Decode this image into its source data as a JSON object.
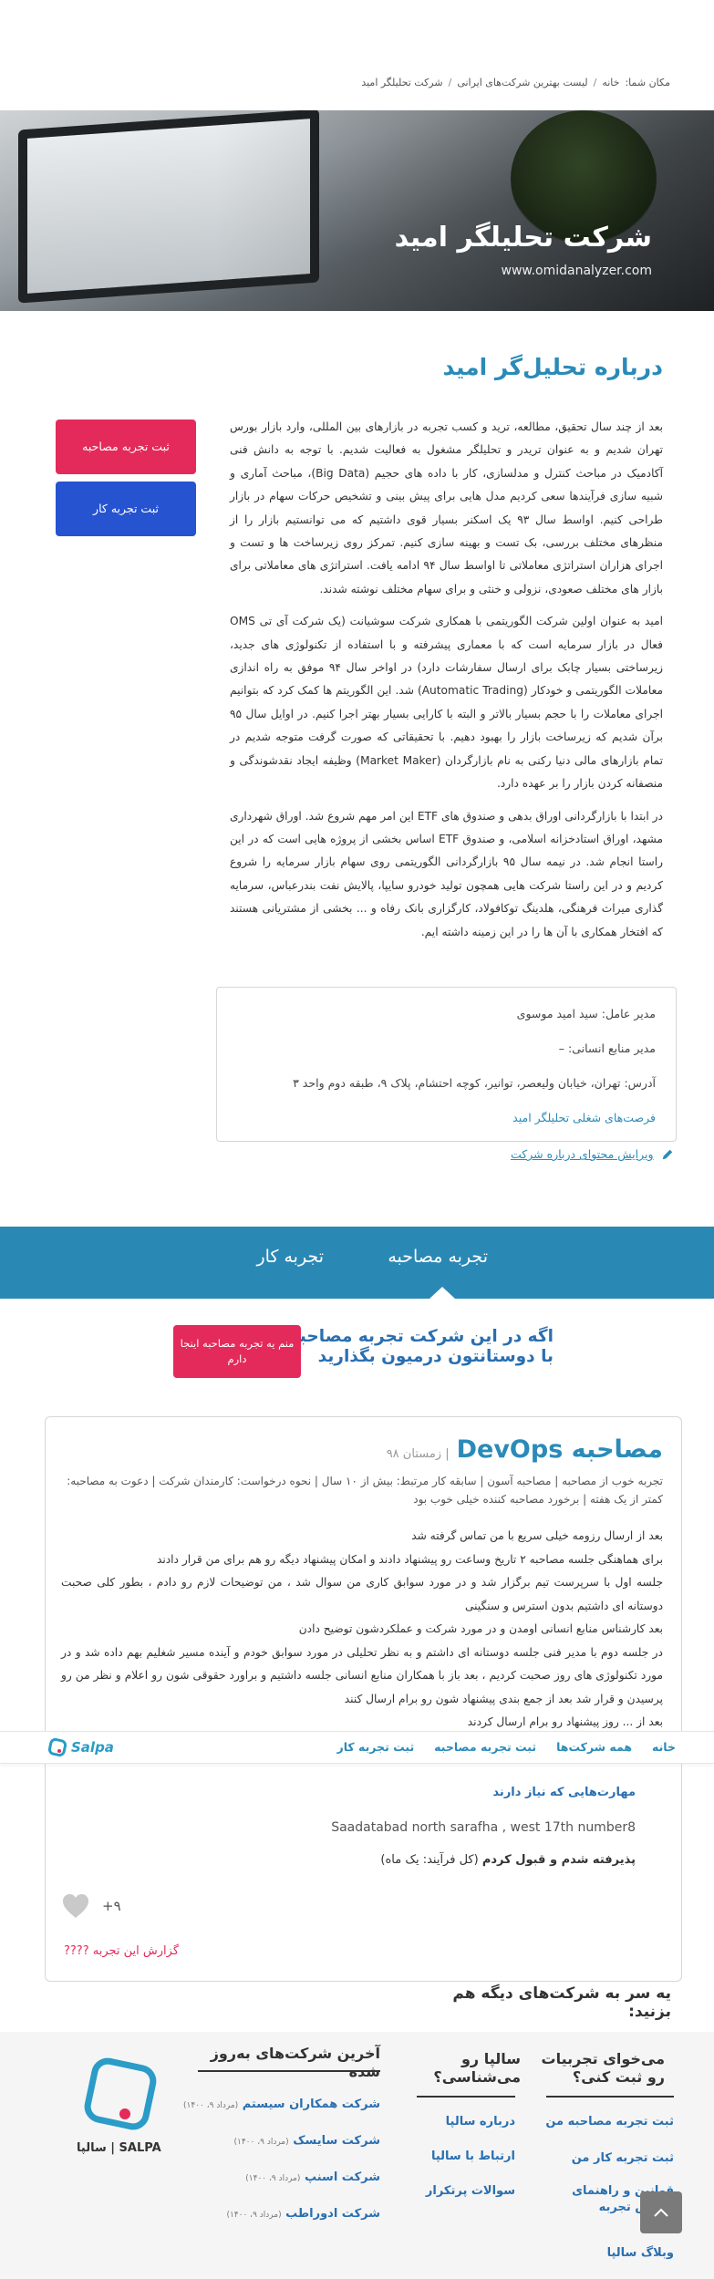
{
  "breadcrumb": {
    "label": "مکان شما:",
    "items": [
      "خانه",
      "لیست بهترین شرکت‌های ایرانی",
      "شرکت تحلیلگر امید"
    ],
    "sep": "/"
  },
  "hero": {
    "title": "شرکت تحلیلگر امید",
    "site": "www.omidanalyzer.com"
  },
  "about": {
    "title": "درباره تحلیل‌گر امید",
    "paragraphs": [
      "بعد از چند سال تحقیق، مطالعه، ترید و کسب تجربه در بازارهای بین المللی، وارد بازار بورس تهران شدیم و به عنوان تریدر و تحلیلگر مشغول به فعالیت شدیم. با توجه به دانش فنی آکادمیک در مباحث کنترل و مدلسازی، کار با داده های حجیم (Big Data)، مباحث آماری و شبیه سازی فرآیندها سعی کردیم مدل هایی برای پیش بینی و تشخیص حرکات سهام در بازار طراحی کنیم. اواسط سال ۹۳ یک اسکنر بسیار قوی داشتیم که می توانستیم بازار را از منظرهای مختلف بررسی، بک تست و بهینه سازی کنیم. تمرکز روی زیرساخت ها و تست و اجرای هزاران استراتژی معاملاتی تا اواسط سال ۹۴ ادامه یافت. استراتژی های معاملاتی برای بازار های مختلف صعودی، نزولی و خنثی و برای سهام مختلف نوشته شدند.",
      "امید به عنوان اولین شرکت الگوریتمی با همکاری شرکت سوشیانت (یک شرکت آی تی OMS فعال در بازار سرمایه است که با معماری پیشرفته و با استفاده از تکنولوژی های جدید، زیرساختی بسیار چابک برای ارسال سفارشات دارد) در اواخر سال ۹۴ موفق به راه اندازی معاملات الگوریتمی و خودکار (Automatic Trading) شد. این الگوریتم ها کمک کرد که بتوانیم اجرای معاملات را با حجم بسیار بالاتر و البته با کارایی بسیار بهتر اجرا کنیم. در اوایل سال ۹۵ برآن شدیم که زیرساخت بازار را بهبود دهیم. با تحقیقاتی که صورت گرفت متوجه شدیم در تمام بازارهای مالی دنیا رکنی به نام بازارگردان (Market Maker) وظیفه ایجاد نقدشوندگی و منصفانه کردن بازار را بر عهده دارد.",
      "در ابتدا با بازارگردانی اوراق بدهی و صندوق های ETF این امر مهم شروع شد. اوراق شهرداری مشهد، اوراق استادخزانه اسلامی، و صندوق ETF اساس بخشی از پروژه هایی است که در این راستا انجام شد. در نیمه سال ۹۵ بازارگردانی الگوریتمی روی سهام بازار سرمایه را شروع کردیم و در این راستا شرکت هایی همچون تولید خودرو سایپا، پالایش نفت بندرعباس، سرمایه گذاری میراث فرهنگی، هلدینگ توکافولاد، کارگزاری بانک رفاه و ... بخشی از مشتریانی هستند که افتخار همکاری با آن ها را در این زمینه داشته ایم."
    ]
  },
  "side_buttons": {
    "interview": "ثبت تجربه مصاحبه",
    "work": "ثبت تجربه کار"
  },
  "info": {
    "ceo": "مدیر عامل: سید امید موسوی",
    "hr": "مدیر منابع انسانی: –",
    "address": "آدرس: تهران، خیابان ولیعصر، توانیر، کوچه احتشام، پلاک ۹، طبقه دوم واحد ۳",
    "jobs_link": "فرصت‌های شغلی تحلیلگر امید",
    "edit_link": "ویرایش محتوای درباره شرکت"
  },
  "tabs": [
    "تجربه مصاحبه",
    "تجربه کار"
  ],
  "cta": {
    "line1": "اگه در این شرکت تجربه مصاحبه دارید،",
    "line2": "با دوستانتون درمیون بگذارید",
    "button": "منم یه تجربه مصاحبه اینجا دارم"
  },
  "review": {
    "title": "مصاحبه DevOps",
    "date": "| زمستان ۹۸",
    "meta": "تجربه خوب از مصاحبه | مصاحبه آسون | سابقه کار مرتبط: بیش از ۱۰ سال | نحوه درخواست: کارمندان شرکت | دعوت به مصاحبه: کمتر از یک هفته | برخورد مصاحبه کننده خیلی خوب بود",
    "body": [
      "بعد از ارسال رزومه خیلی سریع با من تماس گرفته شد",
      "برای هماهنگی جلسه مصاحبه ۲ تاریخ وساعت رو پیشنهاد دادند و امکان پیشنهاد دیگه رو هم برای من قرار دادند",
      "جلسه اول با سرپرست تیم برگزار شد و در مورد سوابق کاری من سوال شد ، من توضیحات لازم رو دادم ، بطور کلی صحبت دوستانه ای داشتیم بدون استرس و سنگینی",
      "بعد کارشناس منابع انسانی اومدن و در مورد شرکت و عملکردشون توضیح دادن",
      "در جلسه دوم با مدیر فنی جلسه دوستانه ای داشتم و به نظر تحلیلی در مورد سوابق خودم و آینده مسیر شغلیم بهم داده شد و در مورد تکنولوژی های روز صحبت کردیم ، بعد باز با همکاران منابع انسانی جلسه داشتیم و براورد حقوقی شون رو اعلام و نظر من رو پرسیدن و قرار شد بعد از جمع بندی پیشنهاد شون رو برام ارسال کنند",
      "بعد از ... روز پیشنهاد رو برام ارسال کردند"
    ],
    "skills_title": "مهارت‌هایی که نیاز دارند",
    "address": "Saadatabad north sarafha , west 17th number8",
    "accepted_bold": "پذیرفته شدم و قبول کردم",
    "accepted_rest": "(کل فرآیند: یک ماه)",
    "likes": "+۹",
    "report": "گزارش این تجربه ????"
  },
  "sticky_nav": {
    "logo": "Salpa",
    "items": [
      "خانه",
      "همه شرکت‌ها",
      "ثبت تجربه مصاحبه",
      "ثبت تجربه کار"
    ]
  },
  "see_also": {
    "line1": "یه سر به شرکت‌های دیگه هم",
    "line2": "بزنید:"
  },
  "footer": {
    "col1_title_1": "می‌خوای تجربیات",
    "col1_title_2": "رو ثبت کنی؟",
    "col1_links": [
      "ثبت تجربه مصاحبه من",
      "ثبت تجربه کار من",
      "قوانین و راهنمای نگارش تجربه",
      "وبلاگ سالپا"
    ],
    "col2_title_1": "سالپا رو",
    "col2_title_2": "می‌شناسی؟",
    "col2_links": [
      "درباره سالپا",
      "ارتباط با سالپا",
      "سوالات پرتکرار"
    ],
    "col3_title": "آخرین شرکت‌های به‌روز شده",
    "col3_items": [
      {
        "name": "شرکت همکاران سیستم",
        "date": "(مرداد ۹، ۱۴۰۰)"
      },
      {
        "name": "شرکت سایسک",
        "date": "(مرداد ۹، ۱۴۰۰)"
      },
      {
        "name": "شرکت اسنپ",
        "date": "(مرداد ۹، ۱۴۰۰)"
      },
      {
        "name": "شرکت ادوراطب",
        "date": "(مرداد ۹، ۱۴۰۰)"
      }
    ],
    "brand": "SALPA | سالپا"
  },
  "colors": {
    "accent_blue": "#2a8bb8",
    "accent_red": "#e42a5a",
    "button_blue": "#2653d0"
  }
}
